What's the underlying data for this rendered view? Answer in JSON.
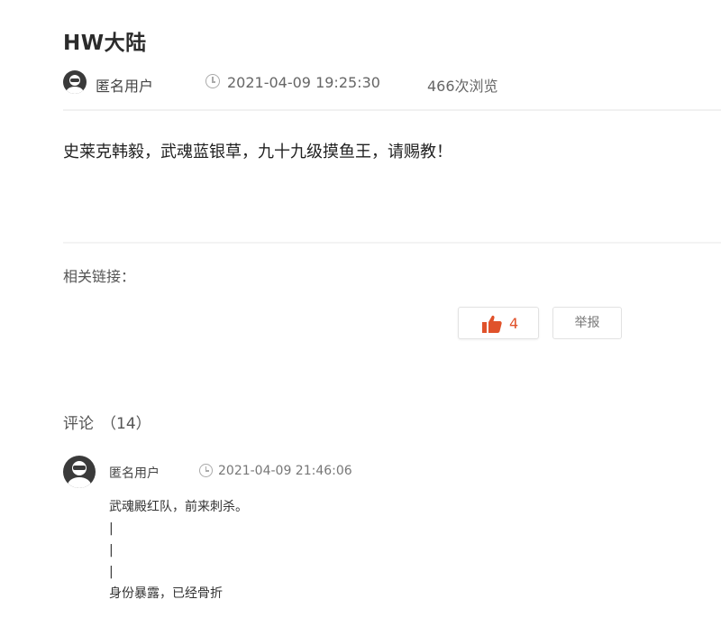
{
  "post": {
    "title": "HW大陆",
    "author": "匿名用户",
    "timestamp": "2021-04-09 19:25:30",
    "views": "466次浏览",
    "body": "史莱克韩毅，武魂蓝银草，九十九级摸鱼王，请赐教！",
    "related_label": "相关链接："
  },
  "actions": {
    "like_count": "4",
    "report_label": "举报",
    "like_color": "#e0522b"
  },
  "comments": {
    "heading": "评论",
    "count": "（14）",
    "items": [
      {
        "author": "匿名用户",
        "timestamp": "2021-04-09 21:46:06",
        "lines": [
          "武魂殿红队，前来刺杀。",
          "|",
          "|",
          "|",
          "身份暴露，已经骨折"
        ]
      }
    ]
  },
  "icons": {
    "avatar": "anonymous-avatar-icon",
    "clock": "clock-icon",
    "like": "thumbs-up-icon"
  }
}
